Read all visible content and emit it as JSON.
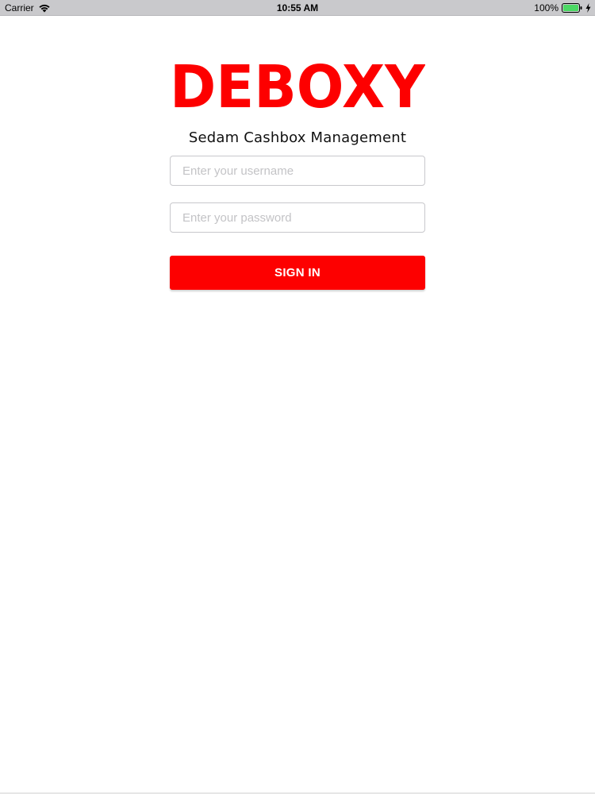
{
  "status_bar": {
    "carrier": "Carrier",
    "time": "10:55 AM",
    "battery_percent": "100%",
    "icons": [
      "wifi-icon",
      "battery-icon",
      "bolt-icon"
    ]
  },
  "brand": {
    "logo_text": "DEBOXY",
    "subtitle": "Sedam Cashbox Management"
  },
  "login": {
    "username_placeholder": "Enter your username",
    "password_placeholder": "Enter your password",
    "submit_label": "SIGN IN"
  },
  "colors": {
    "brand_red": "#fd0000",
    "status_bar": "#c9c9cc",
    "battery_green": "#4cd964"
  }
}
